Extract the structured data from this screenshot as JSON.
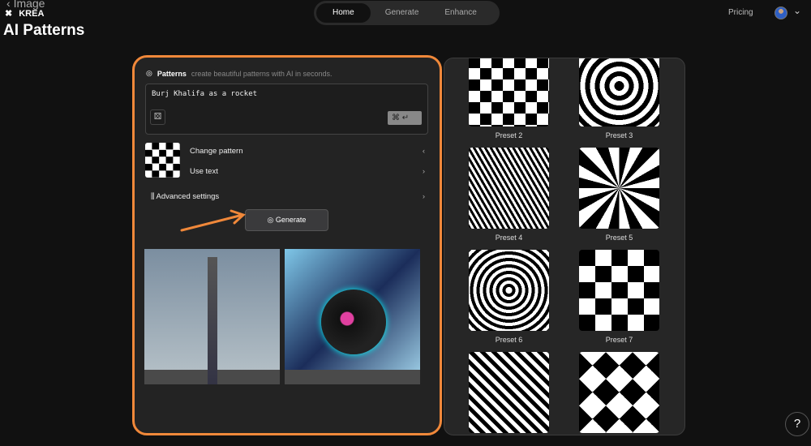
{
  "header": {
    "back_label": "Image",
    "brand": "KREA",
    "page_title": "AI Patterns",
    "nav": [
      {
        "label": "Home",
        "active": true
      },
      {
        "label": "Generate"
      },
      {
        "label": "Enhance"
      }
    ],
    "pricing": "Pricing"
  },
  "panel": {
    "title": "Patterns",
    "subtitle": "create beautiful patterns with AI in seconds.",
    "prompt_value": "Burj Khalifa as a rocket",
    "shortcut": "⌘ ↵",
    "change_pattern": "Change pattern",
    "use_text": "Use text",
    "advanced": "Advanced settings",
    "generate": "Generate"
  },
  "presets": [
    {
      "label": "Preset 2"
    },
    {
      "label": "Preset 3"
    },
    {
      "label": "Preset 4"
    },
    {
      "label": "Preset 5"
    },
    {
      "label": "Preset 6"
    },
    {
      "label": "Preset 7"
    }
  ],
  "help": "?",
  "colors": {
    "accent": "#f0883a"
  }
}
